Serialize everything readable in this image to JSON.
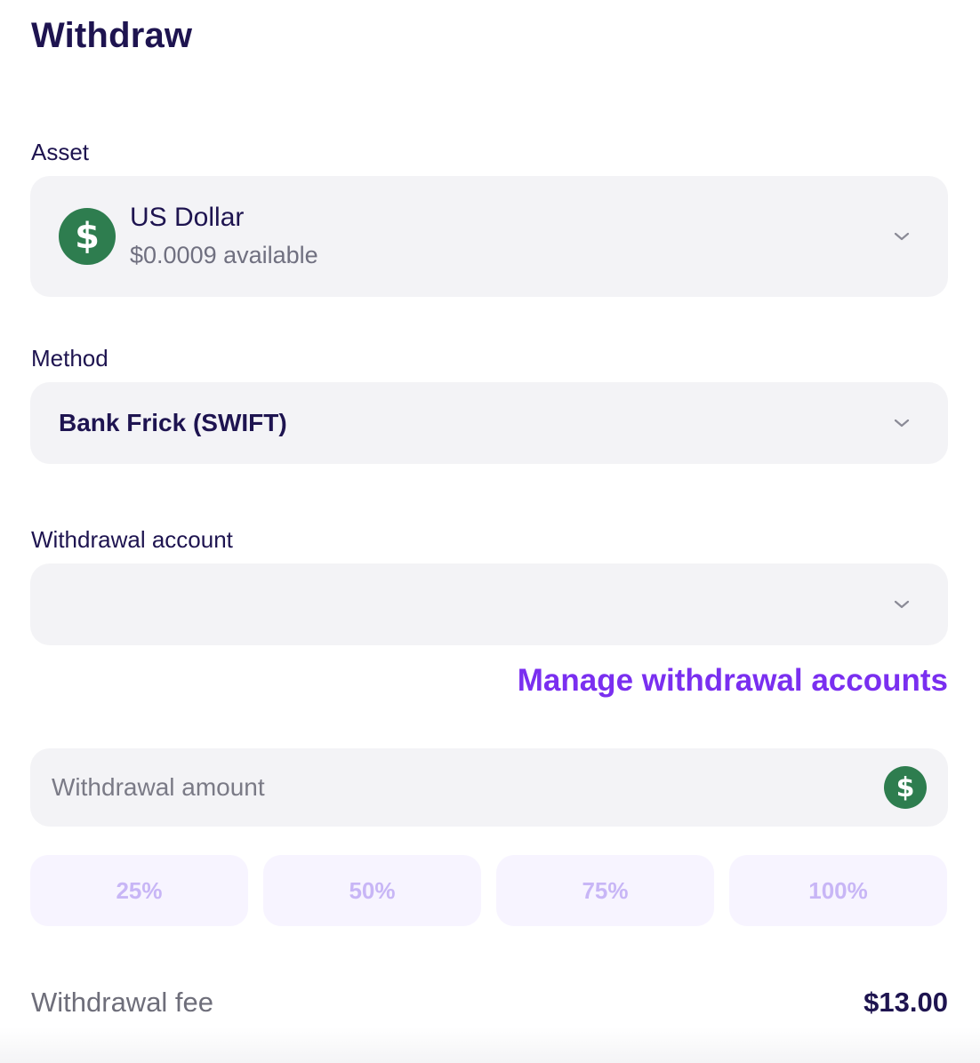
{
  "page": {
    "title": "Withdraw"
  },
  "asset": {
    "label": "Asset",
    "name": "US Dollar",
    "available": "$0.0009 available",
    "icon": "dollar-coin-icon",
    "icon_symbol": "$",
    "icon_color": "#2e7d4f"
  },
  "method": {
    "label": "Method",
    "value": "Bank Frick (SWIFT)"
  },
  "withdrawal_account": {
    "label": "Withdrawal account",
    "value": ""
  },
  "manage_link": {
    "label": "Manage withdrawal accounts",
    "color": "#7a2ff0"
  },
  "amount": {
    "placeholder": "Withdrawal amount",
    "value": "",
    "icon_symbol": "$"
  },
  "percent_buttons": [
    {
      "label": "25%"
    },
    {
      "label": "50%"
    },
    {
      "label": "75%"
    },
    {
      "label": "100%"
    }
  ],
  "fee": {
    "label": "Withdrawal fee",
    "value": "$13.00"
  }
}
